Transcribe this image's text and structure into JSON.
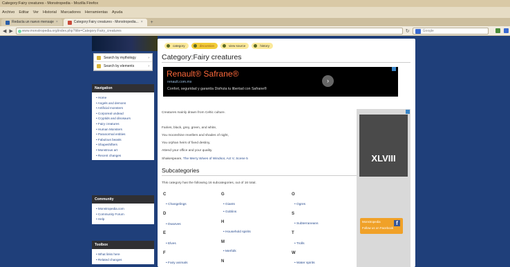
{
  "window": {
    "title": "Category:Fairy creatures - Monstropedia - Mozilla Firefox"
  },
  "menu": [
    "Archivo",
    "Editar",
    "Ver",
    "Historial",
    "Marcadores",
    "Herramientas",
    "Ayuda"
  ],
  "tabs": [
    {
      "label": "Redacta un nuevo mensaje",
      "active": false
    },
    {
      "label": "Category:Fairy creatures - Monstropedia...",
      "active": true
    }
  ],
  "address": {
    "url": "www.monstropedia.org/index.php?title=Category:Fairy_creatures",
    "search_placeholder": "Google"
  },
  "sidebar": {
    "menu_items": [
      "Search by mythology",
      "Search by elements"
    ],
    "nav_header": "Navigation",
    "nav": [
      "Home",
      "Angels and demons",
      "Artificial monsters",
      "Corporeal undead",
      "Cryptids and dinosaurs",
      "Fairy creatures",
      "Human Monsters",
      "Paranormal entities",
      "Fabulous beasts",
      "Shapeshifters",
      "Monstrous art",
      "Recent changes"
    ],
    "community_header": "Community",
    "community": [
      "Monstropedia.com",
      "Community Forum",
      "Help"
    ],
    "toolbox_header": "Toolbox",
    "toolbox": [
      "What links here",
      "Related changes"
    ]
  },
  "page": {
    "tabs": [
      "category",
      "discussion",
      "view source",
      "history"
    ],
    "title": "Category:Fairy creatures",
    "ad": {
      "title": "Renault® Safrane®",
      "url": "renault.com.mx",
      "desc": "Confort, seguridad y garantía Disfruta tu libertad con Safrane®"
    },
    "intro": "Creatures mainly drawn from Celtic culture.",
    "poem": [
      "Fairies, black, grey, green, and white,",
      "You moonshine revellers and shades of night,",
      "You orphan heirs of fixed destiny,",
      "Attend your office and your quality."
    ],
    "quote_author": "Shakespeare",
    "quote_link": "The Merry Wives of Windsor",
    "quote_act": "Act V, Scene 5",
    "subcategories_title": "Subcategories",
    "subcategories_note": "This category has the following 16 subcategories, out of 16 total.",
    "columns": [
      [
        {
          "letter": "C",
          "items": [
            "Changelings"
          ]
        },
        {
          "letter": "D",
          "items": [
            "Dwarves"
          ]
        },
        {
          "letter": "E",
          "items": [
            "Elves"
          ]
        },
        {
          "letter": "F",
          "items": [
            "Fairy animals"
          ]
        }
      ],
      [
        {
          "letter": "G",
          "items": [
            "Giants",
            "Goblins"
          ]
        },
        {
          "letter": "H",
          "items": [
            "Household spirits"
          ]
        },
        {
          "letter": "M",
          "items": [
            "Merfolk"
          ]
        },
        {
          "letter": "N",
          "items": []
        }
      ],
      [
        {
          "letter": "O",
          "items": [
            "Ogres"
          ]
        },
        {
          "letter": "S",
          "items": [
            "Subterraneans"
          ]
        },
        {
          "letter": "T",
          "items": [
            "Trolls"
          ]
        },
        {
          "letter": "W",
          "items": [
            "Water spirits"
          ]
        }
      ]
    ]
  },
  "side_ad": {
    "text": "XLVIII",
    "fb_line1": "Monstropedia",
    "fb_line2": "Follow us on Facebook"
  }
}
